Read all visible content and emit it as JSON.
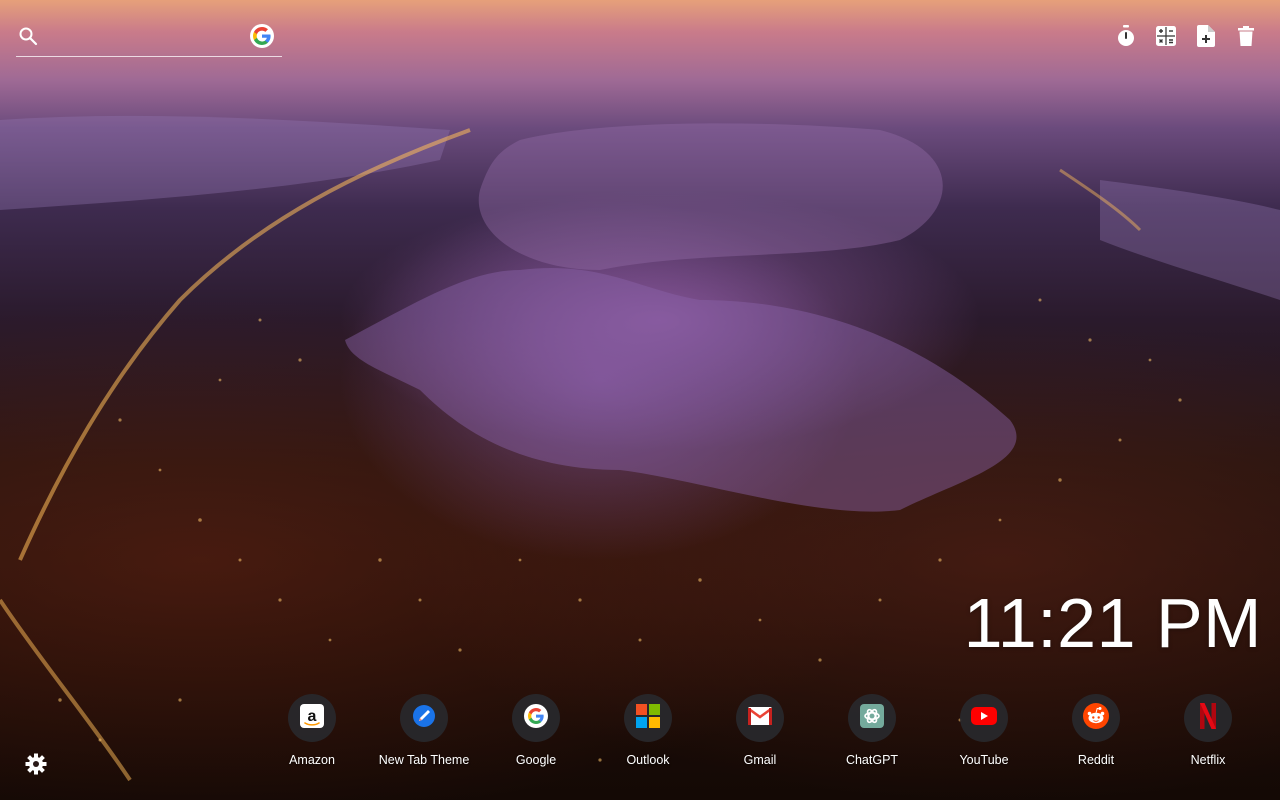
{
  "search": {
    "placeholder": "",
    "value": "",
    "icon": "search-icon",
    "engine_icon": "google-icon"
  },
  "toolbar": {
    "items": [
      {
        "icon": "timer-icon"
      },
      {
        "icon": "calculator-icon"
      },
      {
        "icon": "note-add-icon"
      },
      {
        "icon": "trash-icon"
      }
    ]
  },
  "clock": {
    "time": "11:21 PM"
  },
  "shortcuts": [
    {
      "label": "Amazon",
      "icon": "amazon-icon"
    },
    {
      "label": "New Tab Theme",
      "icon": "new-tab-theme-icon"
    },
    {
      "label": "Google",
      "icon": "google-icon"
    },
    {
      "label": "Outlook",
      "icon": "outlook-icon"
    },
    {
      "label": "Gmail",
      "icon": "gmail-icon"
    },
    {
      "label": "ChatGPT",
      "icon": "chatgpt-icon"
    },
    {
      "label": "YouTube",
      "icon": "youtube-icon"
    },
    {
      "label": "Reddit",
      "icon": "reddit-icon"
    },
    {
      "label": "Netflix",
      "icon": "netflix-icon"
    }
  ],
  "settings": {
    "icon": "gear-icon"
  },
  "colors": {
    "tile_bg": "#28282c",
    "youtube_red": "#ff0000",
    "reddit_orange": "#ff4500",
    "netflix_red": "#e50914",
    "chatgpt_teal": "#74aa9c"
  }
}
